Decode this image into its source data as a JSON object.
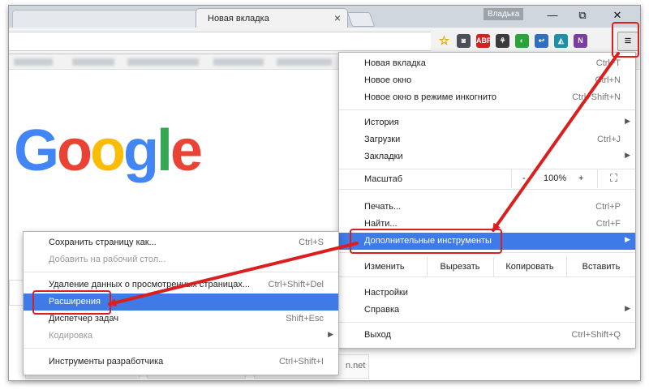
{
  "browser": {
    "tab_title": "Новая вкладка",
    "tab_close": "×",
    "profile_name": "Владька",
    "win_min": "—",
    "win_restore": "⧉",
    "win_close": "✕",
    "menu_icon": "≡"
  },
  "extensions": [
    {
      "name": "star-icon",
      "label": "☆",
      "color": "#e0a800"
    },
    {
      "name": "pocket-icon",
      "label": "◙",
      "color": "#4a4f57"
    },
    {
      "name": "adblock-icon",
      "label": "ABP",
      "color": "#d32020"
    },
    {
      "name": "evernote-icon",
      "label": "⚘",
      "color": "#3b3b3b"
    },
    {
      "name": "extension-green-icon",
      "label": "◐",
      "color": "#2aa33a"
    },
    {
      "name": "extension-blue-icon",
      "label": "↩",
      "color": "#2f6fbf"
    },
    {
      "name": "extension-teal-icon",
      "label": "◭",
      "color": "#1f8fa8"
    },
    {
      "name": "onenote-icon",
      "label": "N",
      "color": "#7a3ea0"
    }
  ],
  "main_menu": {
    "items": [
      {
        "label": "Новая вкладка",
        "shortcut": "Ctrl+T"
      },
      {
        "label": "Новое окно",
        "shortcut": "Ctrl+N"
      },
      {
        "label": "Новое окно в режиме инкогнито",
        "shortcut": "Ctrl+Shift+N"
      },
      {
        "label": "История",
        "shortcut": ""
      },
      {
        "label": "Загрузки",
        "shortcut": "Ctrl+J"
      },
      {
        "label": "Закладки",
        "shortcut": ""
      },
      {
        "label": "Печать...",
        "shortcut": "Ctrl+P"
      },
      {
        "label": "Найти...",
        "shortcut": "Ctrl+F"
      },
      {
        "label": "Дополнительные инструменты",
        "shortcut": ""
      },
      {
        "label": "Настройки",
        "shortcut": ""
      },
      {
        "label": "Справка",
        "shortcut": ""
      },
      {
        "label": "Выход",
        "shortcut": "Ctrl+Shift+Q"
      }
    ],
    "zoom": {
      "label": "Масштаб",
      "minus": "-",
      "value": "100%",
      "plus": "+",
      "fullscreen": "⛶"
    },
    "edit": {
      "label": "Изменить",
      "cut": "Вырезать",
      "copy": "Копировать",
      "paste": "Вставить"
    }
  },
  "sub_menu": {
    "items": [
      {
        "label": "Сохранить страницу как...",
        "shortcut": "Ctrl+S"
      },
      {
        "label": "Добавить на рабочий стол...",
        "shortcut": ""
      },
      {
        "label": "Удаление данных о просмотренных страницах...",
        "shortcut": "Ctrl+Shift+Del"
      },
      {
        "label": "Расширения",
        "shortcut": ""
      },
      {
        "label": "Диспетчер задач",
        "shortcut": "Shift+Esc"
      },
      {
        "label": "Кодировка",
        "shortcut": ""
      },
      {
        "label": "Инструменты разработчика",
        "shortcut": "Ctrl+Shift+I"
      }
    ]
  },
  "page": {
    "google": "Google",
    "tile_partial": "n.net"
  },
  "colors": {
    "accent": "#3e7ae8",
    "annotation": "#d91f1f"
  }
}
